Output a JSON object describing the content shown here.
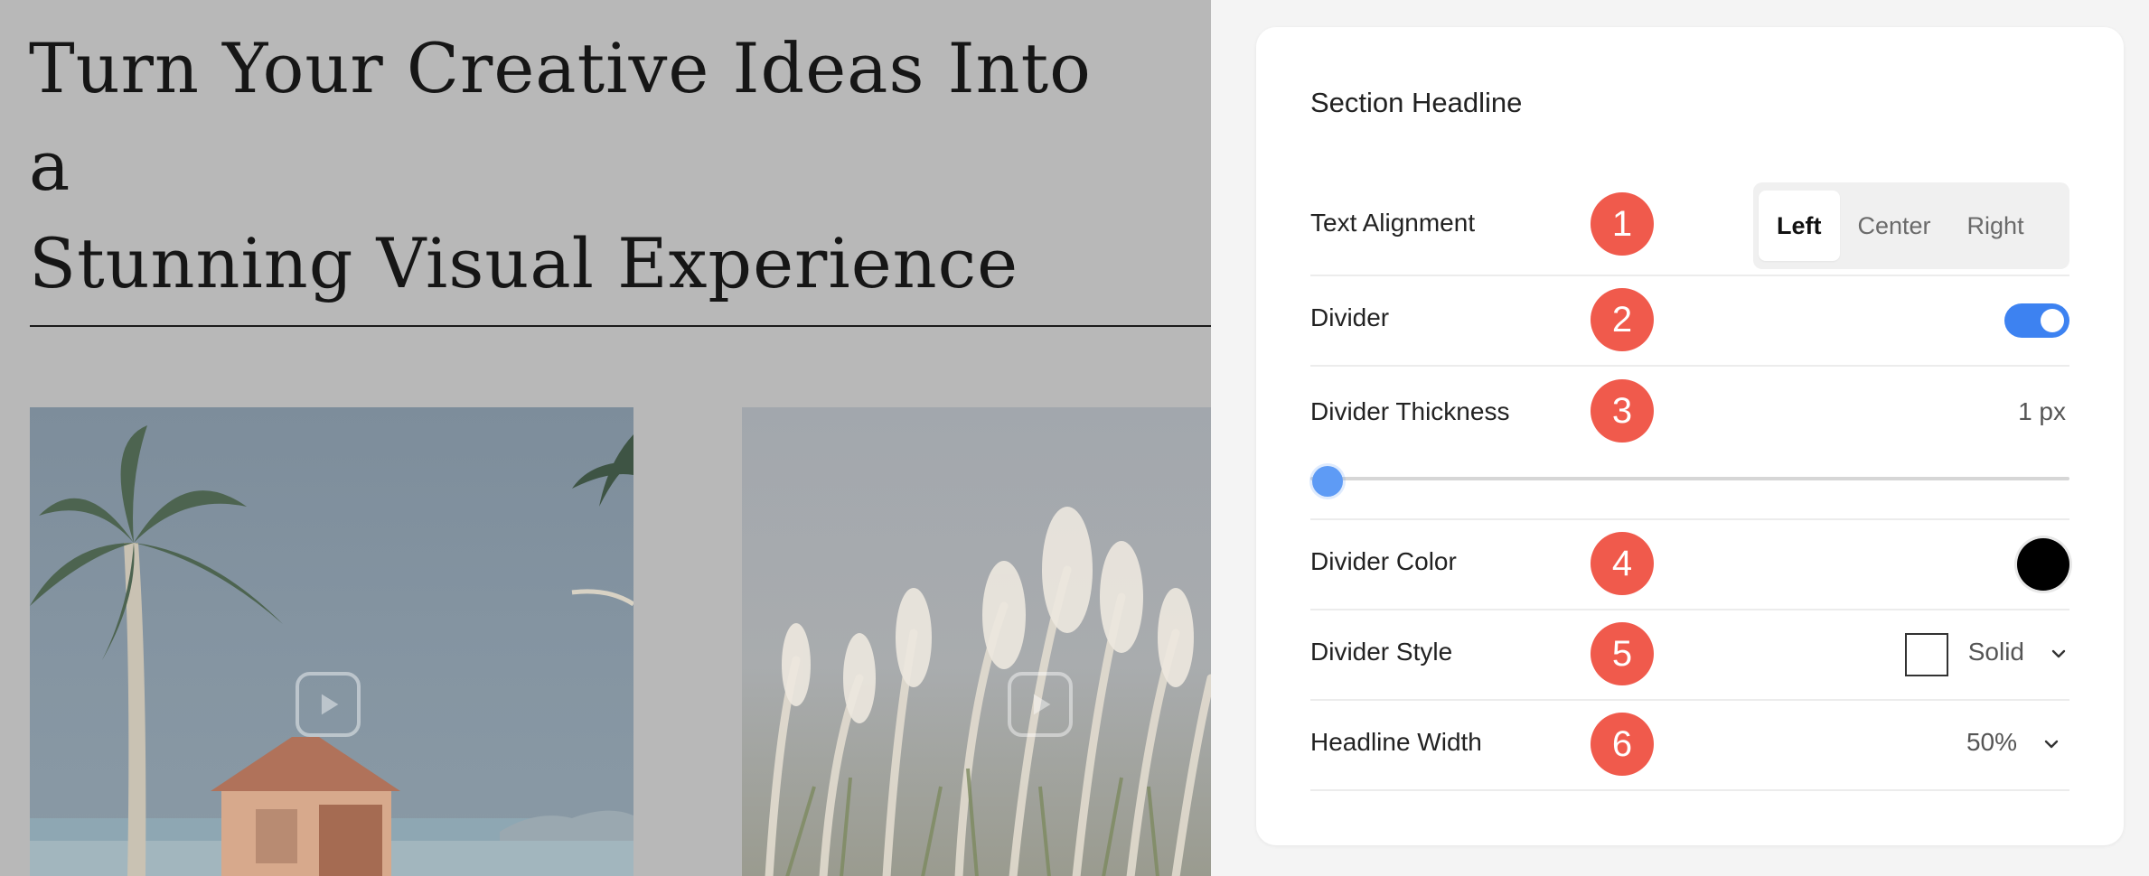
{
  "preview": {
    "headline_lines": [
      "Turn Your Creative Ideas Into a",
      "Stunning Visual Experience"
    ]
  },
  "panel": {
    "title": "Section Headline",
    "rows": [
      {
        "number": "1",
        "label": "Text Alignment",
        "options": [
          "Left",
          "Center",
          "Right"
        ],
        "selected": "Left"
      },
      {
        "number": "2",
        "label": "Divider",
        "toggle_on": true
      },
      {
        "number": "3",
        "label": "Divider Thickness",
        "value": "1 px"
      },
      {
        "number": "4",
        "label": "Divider Color",
        "color": "#000000"
      },
      {
        "number": "5",
        "label": "Divider Style",
        "value": "Solid"
      },
      {
        "number": "6",
        "label": "Headline Width",
        "value": "50%"
      }
    ]
  },
  "colors": {
    "accent": "#3d82f1",
    "badge": "#f05a4c",
    "preview_bg": "#b8b8b8"
  },
  "icons": [
    "play-icon",
    "chevron-down-icon"
  ]
}
